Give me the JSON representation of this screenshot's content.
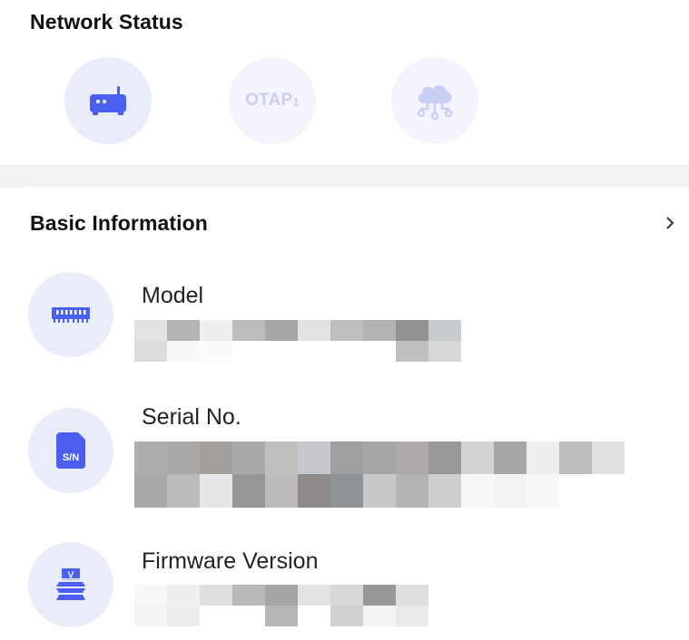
{
  "network_status": {
    "title": "Network Status",
    "items": [
      {
        "icon": "router-icon"
      },
      {
        "icon": "otap-icon",
        "label": "OTAP",
        "subscript": "1"
      },
      {
        "icon": "cloud-network-icon"
      }
    ]
  },
  "basic_information": {
    "title": "Basic Information",
    "chevron": "chevron-right-icon",
    "fields": {
      "model": {
        "label": "Model",
        "icon": "memory-chip-icon",
        "value_redacted": true
      },
      "serial": {
        "label": "Serial No.",
        "icon": "serial-number-icon",
        "badge": "S/N",
        "value_redacted": true
      },
      "firmware": {
        "label": "Firmware Version",
        "icon": "firmware-chip-icon",
        "badge": "V",
        "value_redacted": true
      }
    }
  },
  "colors": {
    "accent": "#4a5ff0",
    "accent_light": "#e8ecfb",
    "accent_disabled": "#c9cef5",
    "divider": "#f2f2f2"
  }
}
